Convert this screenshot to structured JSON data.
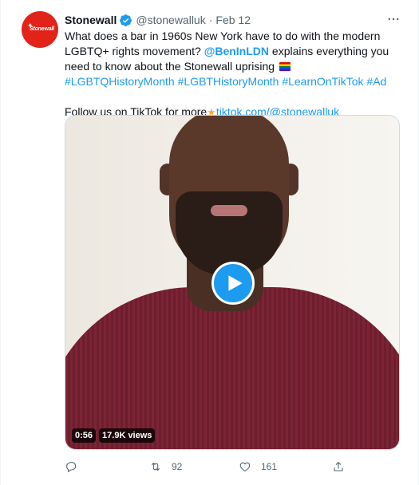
{
  "tweet": {
    "author": {
      "display_name": "Stonewall",
      "handle": "@stonewalluk",
      "date": "Feb 12",
      "avatar_text": "Stonewall",
      "verified": true
    },
    "more_icon": "more-horizontal-icon",
    "text": {
      "p1_a": "What does a bar in 1960s New York have to do with the modern LGBTQ+ rights movement? ",
      "mention": "@BenInLDN",
      "p1_b": " explains everything you need to know about the Stonewall uprising ",
      "hashtag_1": "#LGBTQHistoryMonth",
      "hashtag_2": "#LGBTHistoryMonth",
      "hashtag_3": "#LearnOnTikTok",
      "hashtag_4": "#Ad",
      "p2_a": "Follow us on TikTok for more",
      "p2_link": "tiktok.com/@stonewalluk"
    },
    "media": {
      "type": "video",
      "duration": "0:56",
      "views": "17.9K views",
      "play_icon": "play-icon"
    },
    "actions": {
      "reply_count": "",
      "retweet_count": "92",
      "like_count": "161"
    },
    "colors": {
      "accent": "#1d9bf0",
      "brand": "#e2231a",
      "muted": "#536471"
    }
  }
}
